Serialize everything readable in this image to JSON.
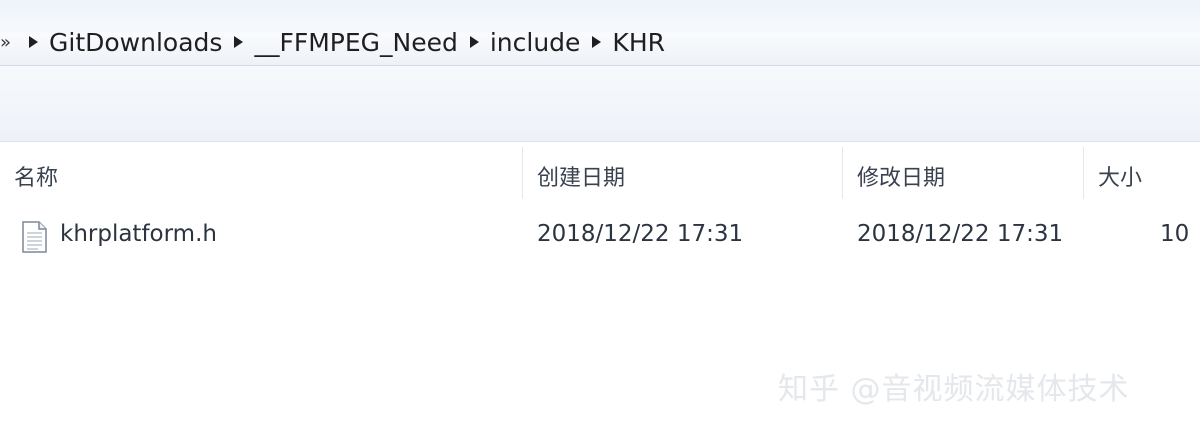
{
  "breadcrumb": {
    "partial_start": "»",
    "items": [
      "GitDownloads",
      "__FFMPEG_Need",
      "include",
      "KHR"
    ]
  },
  "columns": {
    "name": "名称",
    "created": "创建日期",
    "modified": "修改日期",
    "size": "大小"
  },
  "files": [
    {
      "name": "khrplatform.h",
      "created": "2018/12/22 17:31",
      "modified": "2018/12/22 17:31",
      "size": "10"
    }
  ],
  "watermark": "知乎 @音视频流媒体技术",
  "icons": {
    "separator": "triangle-right-icon",
    "file": "document-file-icon"
  },
  "colors": {
    "address_bar": "#eef3f9",
    "header_text": "#3a4250",
    "row_text": "#2c3440",
    "watermark": "#e4e7eb"
  }
}
